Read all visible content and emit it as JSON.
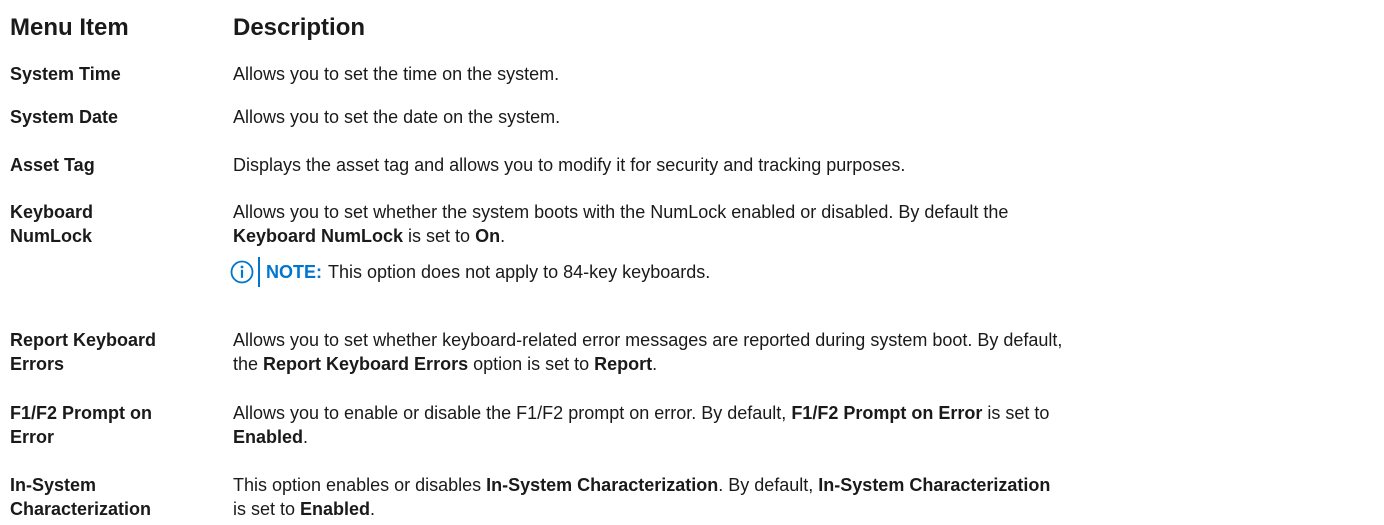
{
  "header": {
    "item": "Menu Item",
    "description": "Description"
  },
  "rows": [
    {
      "item_line1": "System Time",
      "desc": "Allows you to set the time on the system."
    },
    {
      "item_line1": "System Date",
      "desc": "Allows you to set the date on the system."
    },
    {
      "item_line1": "Asset Tag",
      "desc": "Displays the asset tag and allows you to modify it for security and tracking purposes."
    },
    {
      "item_line1": "Keyboard",
      "item_line2": "NumLock",
      "desc_line1": "Allows you to set whether the system boots with the NumLock enabled or disabled. By default the",
      "desc_bold1": "Keyboard NumLock",
      "desc_mid": " is set to ",
      "desc_bold2": "On",
      "desc_end": ".",
      "note_label": "NOTE:",
      "note_text": "This option does not apply to 84-key keyboards.",
      "note_icon": "info-circle-icon"
    },
    {
      "item_line1": "Report Keyboard",
      "item_line2": "Errors",
      "desc_line1": "Allows you to set whether keyboard-related error messages are reported during system boot. By default,",
      "desc_pre": "the ",
      "desc_bold1": "Report Keyboard Errors",
      "desc_mid": " option is set to ",
      "desc_bold2": "Report",
      "desc_end": "."
    },
    {
      "item_line1": "F1/F2 Prompt on",
      "item_line2": "Error",
      "desc_line1_pre": "Allows you to enable or disable the F1/F2 prompt on error. By default, ",
      "desc_bold1": "F1/F2 Prompt on Error",
      "desc_line1_post": " is set to",
      "desc_bold2": "Enabled",
      "desc_end": "."
    },
    {
      "item_line1": "In-System",
      "item_line2": "Characterization",
      "desc_line1_pre": "This option enables or disables ",
      "desc_bold1": "In-System Characterization",
      "desc_line1_mid": ". By default, ",
      "desc_bold2": "In-System Characterization",
      "desc_pre2": "is set to ",
      "desc_bold3": "Enabled",
      "desc_end": "."
    }
  ],
  "colors": {
    "accent": "#0076ce",
    "text": "#1a1a1a"
  }
}
